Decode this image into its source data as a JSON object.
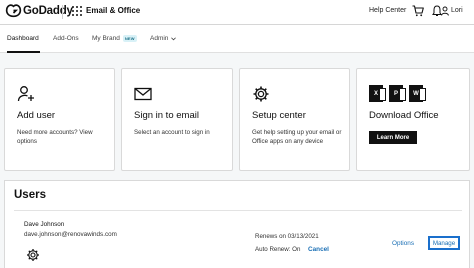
{
  "header": {
    "brand": "GoDaddy",
    "product": "Email & Office",
    "help": "Help Center",
    "user": "Lori",
    "icons": [
      "godaddy-logo",
      "apps-grid-icon",
      "cart-icon",
      "bell-icon",
      "user-icon"
    ]
  },
  "nav": {
    "items": [
      {
        "label": "Dashboard",
        "active": true
      },
      {
        "label": "Add-Ons"
      },
      {
        "label": "My Brand",
        "badge": "NEW"
      },
      {
        "label": "Admin",
        "dropdown": true
      }
    ]
  },
  "cards": [
    {
      "icon": "user-plus-icon",
      "title": "Add user",
      "desc": "Need more accounts? View options"
    },
    {
      "icon": "envelope-icon",
      "title": "Sign in to email",
      "desc": "Select an account to sign in"
    },
    {
      "icon": "gear-icon",
      "title": "Setup center",
      "desc": "Get help setting up your email or Office apps on any device"
    },
    {
      "icon": "office-apps-icon",
      "title": "Download Office",
      "button": "Learn More",
      "apps": [
        "X",
        "P",
        "W"
      ]
    }
  ],
  "users": {
    "title": "Users",
    "rows": [
      {
        "name": "Dave Johnson",
        "email": "dave.johnson@renovawinds.com",
        "renews": "Renews on 03/13/2021",
        "auto_renew": "Auto Renew: On",
        "cancel": "Cancel",
        "options": "Options",
        "manage": "Manage"
      }
    ]
  },
  "colors": {
    "link": "#1a6fb5",
    "accent_border": "#1a6fcc",
    "badge_bg": "#d8f1f7"
  }
}
